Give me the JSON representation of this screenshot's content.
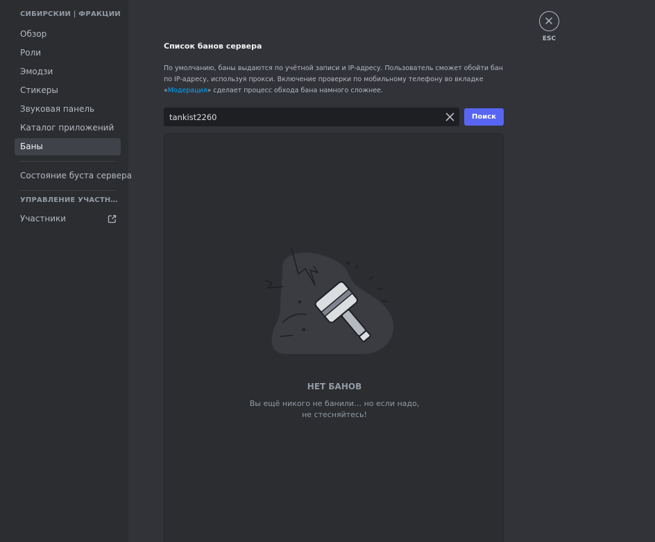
{
  "sidebar": {
    "server_header": "СИБИРСКИЙ | ФРАКЦИИ",
    "items": [
      {
        "label": "Обзор"
      },
      {
        "label": "Роли"
      },
      {
        "label": "Эмодзи"
      },
      {
        "label": "Стикеры"
      },
      {
        "label": "Звуковая панель"
      },
      {
        "label": "Каталог приложений"
      },
      {
        "label": "Баны",
        "active": true
      }
    ],
    "boost_item": "Состояние буста сервера",
    "members_header": "УПРАВЛЕНИЕ УЧАСТНИКА...",
    "members_item": "Участники"
  },
  "main": {
    "title": "Список банов сервера",
    "description_part1": "По умолчанию, баны выдаются по учётной записи и IP-адресу. Пользователь сможет обойти бан по IP-адресу, используя прокси. Включение проверки по мобильному телефону во вкладке «",
    "description_link": "Модерация",
    "description_part2": "» сделает процесс обхода бана намного сложнее.",
    "search": {
      "value": "tankist2260",
      "button_label": "Поиск"
    },
    "empty_state": {
      "title": "НЕТ БАНОВ",
      "text": "Вы ещё никого не банили… но если надо, не стесняйтесь!"
    }
  },
  "close": {
    "label": "ESC"
  },
  "colors": {
    "background": "#313338",
    "sidebar": "#2b2d31",
    "accent": "#5865f2",
    "link": "#00a8fc",
    "active_item": "#404249"
  }
}
